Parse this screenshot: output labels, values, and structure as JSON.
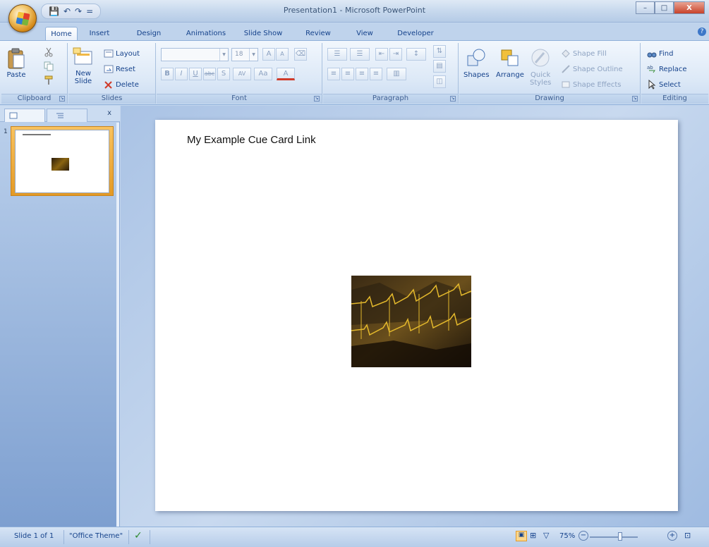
{
  "window": {
    "title": "Presentation1 - Microsoft PowerPoint",
    "controls": {
      "minimize": "–",
      "maximize": "□",
      "close": "X"
    }
  },
  "quick_access": {
    "save": "💾",
    "undo": "↶",
    "redo": "↷",
    "customize": "="
  },
  "tabs": [
    {
      "label": "Home",
      "active": true
    },
    {
      "label": "Insert"
    },
    {
      "label": "Design"
    },
    {
      "label": "Animations"
    },
    {
      "label": "Slide Show"
    },
    {
      "label": "Review"
    },
    {
      "label": "View"
    },
    {
      "label": "Developer"
    }
  ],
  "ribbon": {
    "clipboard": {
      "label": "Clipboard",
      "paste": "Paste"
    },
    "slides": {
      "label": "Slides",
      "new_slide_line1": "New",
      "new_slide_line2": "Slide",
      "layout": "Layout",
      "reset": "Reset",
      "delete": "Delete"
    },
    "font": {
      "label": "Font",
      "font_size": "18",
      "bold": "B",
      "italic": "I",
      "underline": "U",
      "strike": "abc",
      "shadow": "S",
      "spacing": "AV",
      "case": "Aa",
      "color": "A",
      "grow": "A",
      "shrink": "A"
    },
    "paragraph": {
      "label": "Paragraph"
    },
    "drawing": {
      "label": "Drawing",
      "shapes": "Shapes",
      "arrange": "Arrange",
      "quick_styles_line1": "Quick",
      "quick_styles_line2": "Styles",
      "shape_fill": "Shape Fill",
      "shape_outline": "Shape Outline",
      "shape_effects": "Shape Effects"
    },
    "editing": {
      "label": "Editing",
      "find": "Find",
      "replace": "Replace",
      "select": "Select"
    }
  },
  "slide_pane": {
    "thumbnail_number": "1"
  },
  "slide": {
    "title": "My Example Cue Card Link"
  },
  "status": {
    "slide_counter": "Slide 1 of 1",
    "theme": "\"Office Theme\"",
    "zoom": "75%"
  },
  "colors": {
    "ribbon_text": "#15428b",
    "accent": "#e49a25"
  }
}
